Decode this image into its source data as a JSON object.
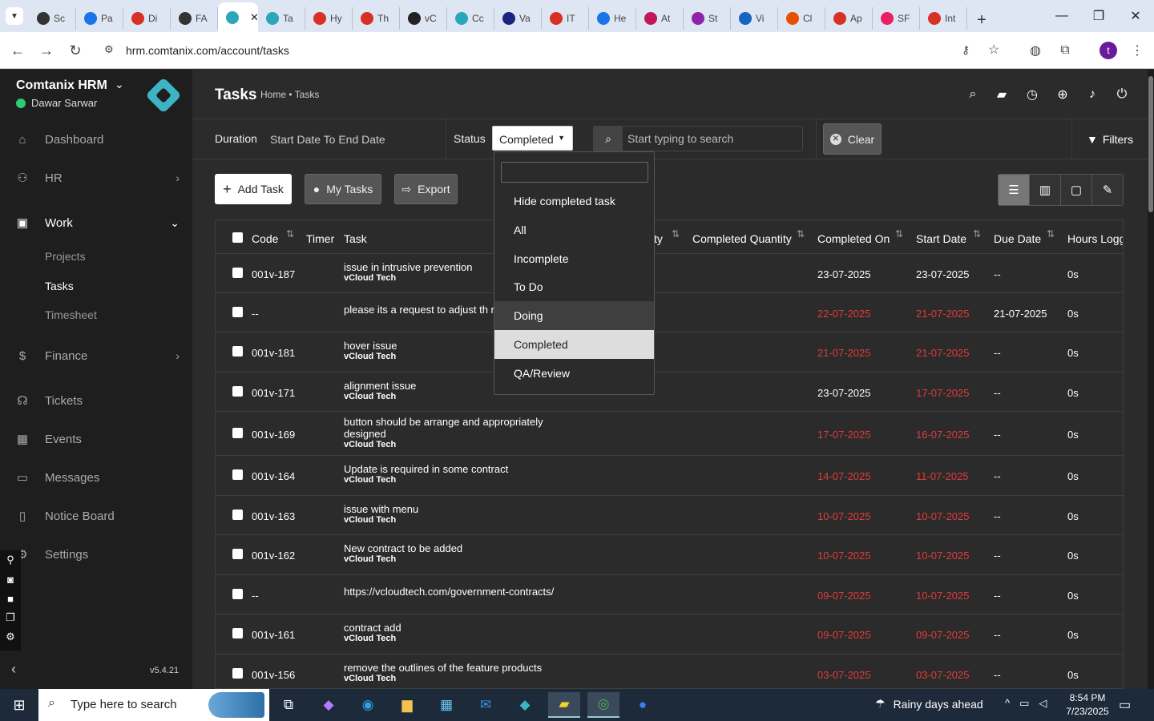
{
  "browser": {
    "tabs": [
      {
        "label": "Sc",
        "color": "#333333"
      },
      {
        "label": "Pa",
        "color": "#1a73e8"
      },
      {
        "label": "Di",
        "color": "#d93025"
      },
      {
        "label": "FA",
        "color": "#333333"
      },
      {
        "label": "",
        "color": "#2aa7b8",
        "active": true
      },
      {
        "label": "Ta",
        "color": "#2aa7b8"
      },
      {
        "label": "Hy",
        "color": "#d93025"
      },
      {
        "label": "Th",
        "color": "#d93025"
      },
      {
        "label": "vC",
        "color": "#222222"
      },
      {
        "label": "Cc",
        "color": "#2aa7b8"
      },
      {
        "label": "Va",
        "color": "#1a237e"
      },
      {
        "label": "IT",
        "color": "#d93025"
      },
      {
        "label": "He",
        "color": "#1a73e8"
      },
      {
        "label": "At",
        "color": "#c2185b"
      },
      {
        "label": "St",
        "color": "#8e24aa"
      },
      {
        "label": "Vi",
        "color": "#1565c0"
      },
      {
        "label": "Cl",
        "color": "#e65100"
      },
      {
        "label": "Ap",
        "color": "#d93025"
      },
      {
        "label": "SF",
        "color": "#e91e63"
      },
      {
        "label": "Int",
        "color": "#d93025"
      }
    ],
    "url": "hrm.comtanix.com/account/tasks",
    "profile_initial": "t"
  },
  "sidebar": {
    "brand": "Comtanix HRM",
    "user": "Dawar Sarwar",
    "items": [
      {
        "label": "Dashboard",
        "icon": "home-icon"
      },
      {
        "label": "HR",
        "icon": "users-icon"
      },
      {
        "label": "Work",
        "icon": "briefcase-icon"
      },
      {
        "label": "Finance",
        "icon": "dollar-icon"
      },
      {
        "label": "Tickets",
        "icon": "headset-icon"
      },
      {
        "label": "Events",
        "icon": "calendar-icon"
      },
      {
        "label": "Messages",
        "icon": "message-icon"
      },
      {
        "label": "Notice Board",
        "icon": "clipboard-icon"
      },
      {
        "label": "Settings",
        "icon": "gear-icon"
      }
    ],
    "work_sub": [
      "Projects",
      "Tasks",
      "Timesheet"
    ],
    "version": "v5.4.21"
  },
  "header": {
    "title": "Tasks",
    "breadcrumb": "Home • Tasks"
  },
  "filters": {
    "duration_label": "Duration",
    "duration_value": "Start Date To End Date",
    "status_label": "Status",
    "status_value": "Completed",
    "search_placeholder": "Start typing to search",
    "clear_label": "Clear",
    "filters_label": "Filters"
  },
  "actions": {
    "add_task": "Add Task",
    "my_tasks": "My Tasks",
    "export": "Export"
  },
  "table": {
    "headers": {
      "code": "Code",
      "timer": "Timer",
      "task": "Task",
      "quantity_partial": "ty",
      "completed_quantity": "Completed Quantity",
      "completed_on": "Completed On",
      "start_date": "Start Date",
      "due_date": "Due Date",
      "hours_logged": "Hours Logg"
    },
    "rows": [
      {
        "code": "001v-187",
        "task": "issue in intrusive prevention",
        "project": "vCloud Tech",
        "completed_on": "23-07-2025",
        "start_date": "23-07-2025",
        "due_date": "--",
        "hours": "0s",
        "completed_red": false,
        "start_red": false
      },
      {
        "code": "--",
        "task": "please its a request to adjust th remove",
        "project": "",
        "completed_on": "22-07-2025",
        "start_date": "21-07-2025",
        "due_date": "21-07-2025",
        "hours": "0s",
        "completed_red": true,
        "start_red": true
      },
      {
        "code": "001v-181",
        "task": "hover issue",
        "project": "vCloud Tech",
        "completed_on": "21-07-2025",
        "start_date": "21-07-2025",
        "due_date": "--",
        "hours": "0s",
        "completed_red": true,
        "start_red": true
      },
      {
        "code": "001v-171",
        "task": "alignment issue",
        "project": "vCloud Tech",
        "completed_on": "23-07-2025",
        "start_date": "17-07-2025",
        "due_date": "--",
        "hours": "0s",
        "completed_red": false,
        "start_red": true
      },
      {
        "code": "001v-169",
        "task": "button should be arrange and appropriately designed",
        "project": "vCloud Tech",
        "completed_on": "17-07-2025",
        "start_date": "16-07-2025",
        "due_date": "--",
        "hours": "0s",
        "completed_red": true,
        "start_red": true
      },
      {
        "code": "001v-164",
        "task": "Update is required in some contract",
        "project": "vCloud Tech",
        "completed_on": "14-07-2025",
        "start_date": "11-07-2025",
        "due_date": "--",
        "hours": "0s",
        "completed_red": true,
        "start_red": true
      },
      {
        "code": "001v-163",
        "task": "issue with menu",
        "project": "vCloud Tech",
        "completed_on": "10-07-2025",
        "start_date": "10-07-2025",
        "due_date": "--",
        "hours": "0s",
        "completed_red": true,
        "start_red": true
      },
      {
        "code": "001v-162",
        "task": "New contract to be added",
        "project": "vCloud Tech",
        "completed_on": "10-07-2025",
        "start_date": "10-07-2025",
        "due_date": "--",
        "hours": "0s",
        "completed_red": true,
        "start_red": true
      },
      {
        "code": "--",
        "task": "https://vcloudtech.com/government-contracts/",
        "project": "",
        "completed_on": "09-07-2025",
        "start_date": "10-07-2025",
        "due_date": "--",
        "hours": "0s",
        "completed_red": true,
        "start_red": true
      },
      {
        "code": "001v-161",
        "task": "contract add",
        "project": "vCloud Tech",
        "completed_on": "09-07-2025",
        "start_date": "09-07-2025",
        "due_date": "--",
        "hours": "0s",
        "completed_red": true,
        "start_red": true
      },
      {
        "code": "001v-156",
        "task": "remove the outlines of the feature products",
        "project": "vCloud Tech",
        "completed_on": "03-07-2025",
        "start_date": "03-07-2025",
        "due_date": "--",
        "hours": "0s",
        "completed_red": true,
        "start_red": true
      }
    ]
  },
  "status_dropdown": {
    "options": [
      "Hide completed task",
      "All",
      "Incomplete",
      "To Do",
      "Doing",
      "Completed",
      "QA/Review"
    ],
    "selected": "Completed",
    "hovered": "Doing"
  },
  "taskbar": {
    "search_placeholder": "Type here to search",
    "weather": "Rainy days ahead",
    "time": "8:54 PM",
    "date": "7/23/2025"
  },
  "colors": {
    "accent_red": "#e03b3b",
    "brand_teal": "#3cb4c4",
    "online_green": "#2ecc71"
  }
}
